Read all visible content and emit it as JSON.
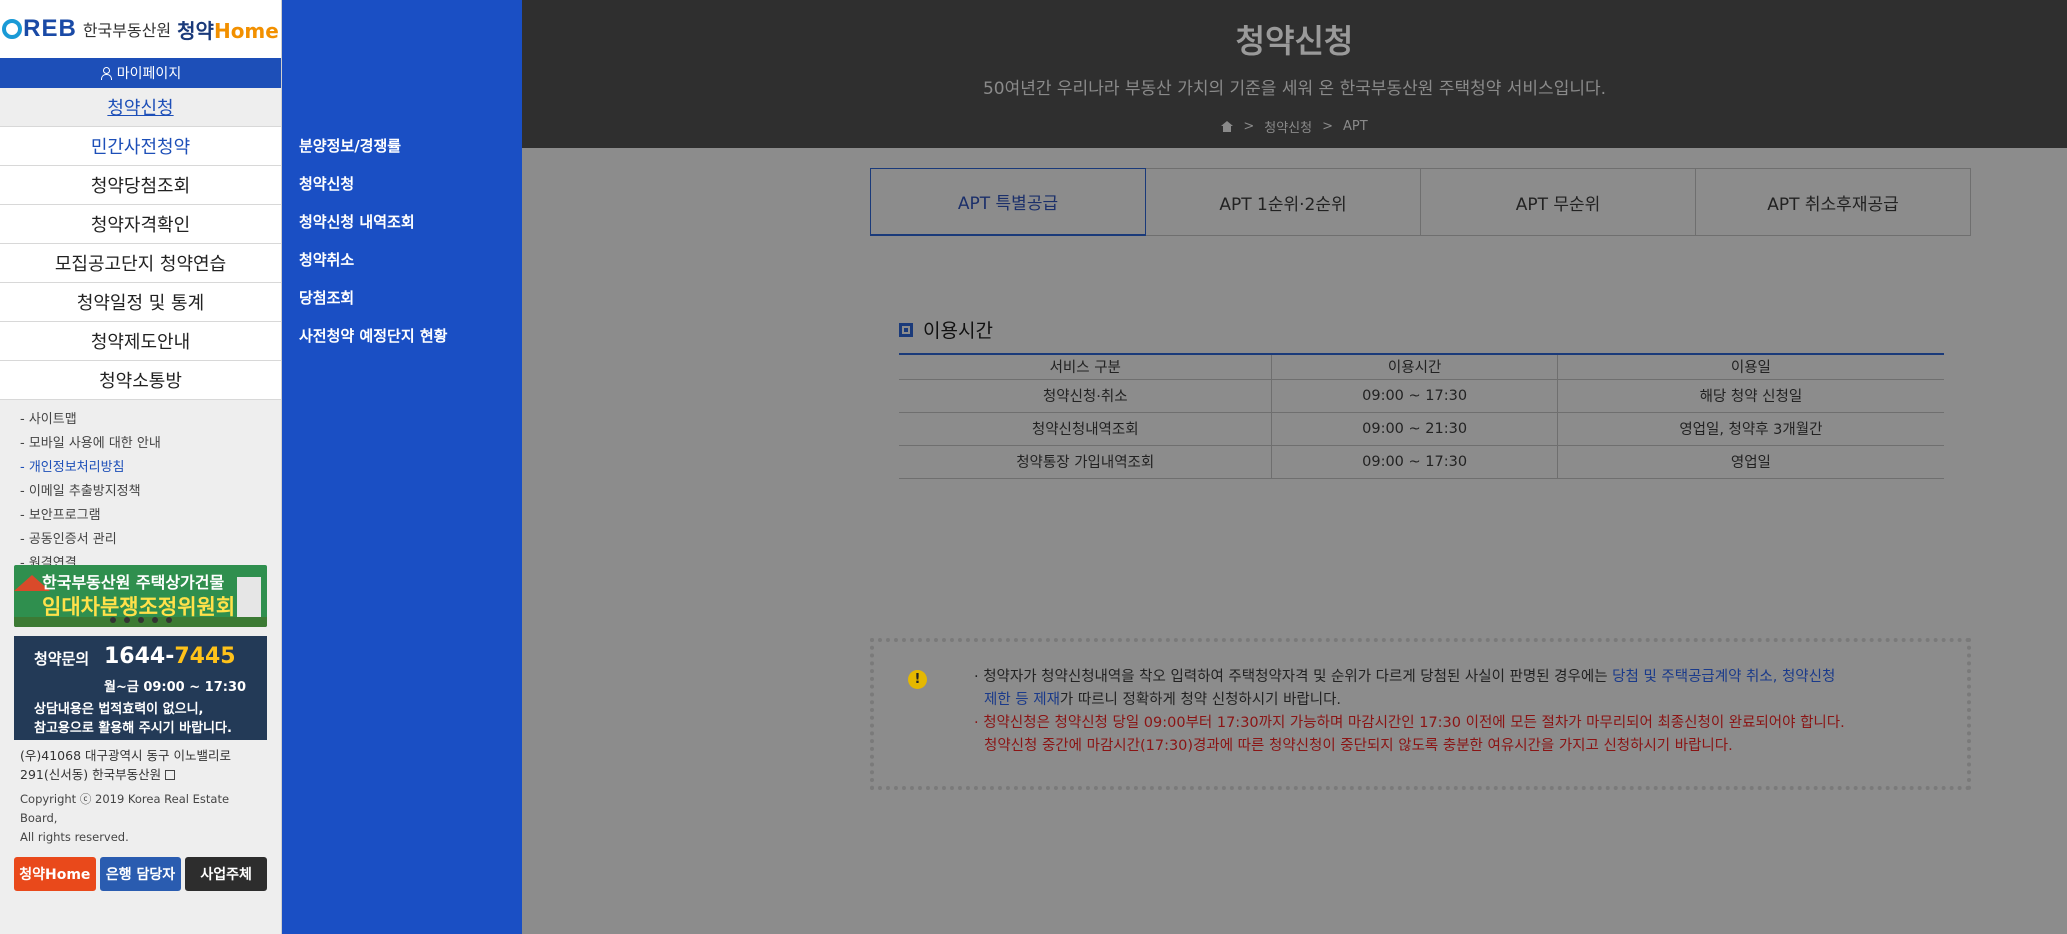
{
  "logo": {
    "reb": "REB",
    "kr": "한국부동산원",
    "brand": "청약",
    "home": "Home"
  },
  "mypage": "마이페이지",
  "main_menu": [
    "청약신청",
    "민간사전청약",
    "청약당첨조회",
    "청약자격확인",
    "모집공고단지 청약연습",
    "청약일정 및 통계",
    "청약제도안내",
    "청약소통방"
  ],
  "sub_links": [
    "- 사이트맵",
    "- 모바일 사용에 대한 안내",
    "- 개인정보처리방침",
    "- 이메일 추출방지정책",
    "- 보안프로그램",
    "- 공동인증서 관리",
    "- 원격연결"
  ],
  "banner": {
    "line1": "한국부동산원 주택상가건물",
    "line2": "임대차분쟁조정위원회"
  },
  "contact": {
    "title": "청약문의",
    "phone_a": "1644-",
    "phone_b": "7445",
    "hours": "월~금 09:00 ~ 17:30",
    "note1": "상담내용은 법적효력이 없으니,",
    "note2": "참고용으로 활용해 주시기 바랍니다."
  },
  "address": {
    "line1": "(우)41068 대구광역시 동구 이노밸리로",
    "line2": "291(신서동) 한국부동산원"
  },
  "copyright": {
    "line1": "Copyright ⓒ 2019 Korea Real Estate Board,",
    "line2": "All rights reserved."
  },
  "bottom_buttons": {
    "home": "청약Home",
    "bank": "은행 담당자",
    "biz": "사업주체"
  },
  "submenu": [
    "분양정보/경쟁률",
    "청약신청",
    "청약신청 내역조회",
    "청약취소",
    "당첨조회",
    "사전청약 예정단지 현황"
  ],
  "header": {
    "title": "청약신청",
    "subtitle": "50여년간 우리나라 부동산 가치의 기준을 세워 온 한국부동산원 주택청약 서비스입니다.",
    "breadcrumb": [
      "청약신청",
      "APT"
    ]
  },
  "tabs": [
    "APT 특별공급",
    "APT 1순위·2순위",
    "APT 무순위",
    "APT 취소후재공급"
  ],
  "usage": {
    "title": "이용시간",
    "columns": [
      "서비스 구분",
      "이용시간",
      "이용일"
    ],
    "rows": [
      [
        "청약신청·취소",
        "09:00 ~ 17:30",
        "해당 청약 신청일"
      ],
      [
        "청약신청내역조회",
        "09:00 ~ 21:30",
        "영업일, 청약후 3개월간"
      ],
      [
        "청약통장 가입내역조회",
        "09:00 ~ 17:30",
        "영업일"
      ]
    ]
  },
  "notice": {
    "l1a": "· 청약자가 청약신청내역을 착오 입력하여 주택청약자격 및 순위가 다르게 당첨된 사실이 판명된 경우에는 ",
    "l1b": "당첨 및 주택공급계약 취소, 청약신청",
    "l2a": "제한 등 제재",
    "l2b": "가 따르니 정확하게 청약 신청하시기 바랍니다.",
    "l3": "· 청약신청은 청약신청 당일 09:00부터 17:30까지 가능하며 마감시간인 17:30 이전에 모든 절차가 마무리되어 최종신청이 완료되어야 합니다.",
    "l4": "청약신청 중간에 마감시간(17:30)경과에 따른 청약신청이 중단되지 않도록 충분한 여유시간을 가지고 신청하시기 바랍니다."
  }
}
